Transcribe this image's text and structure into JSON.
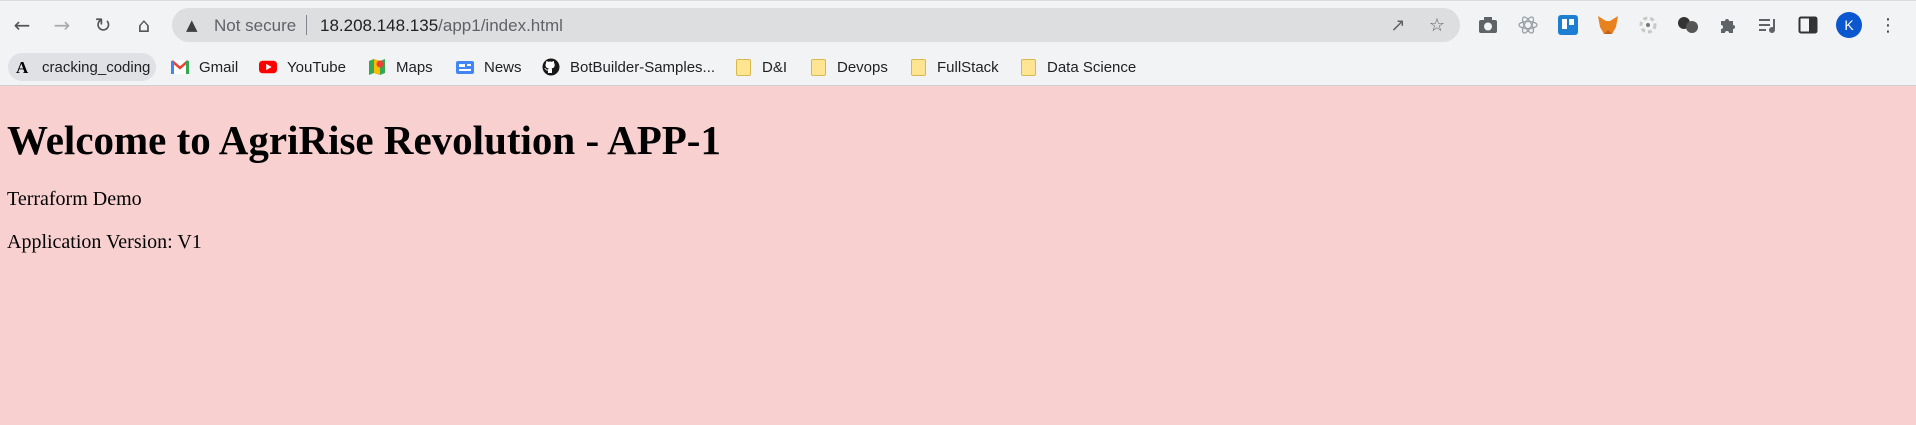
{
  "browser": {
    "omnibox": {
      "security_label": "Not secure",
      "url_host": "18.208.148.135",
      "url_path": "/app1/index.html"
    },
    "profile_initial": "K"
  },
  "bookmarks": [
    {
      "label": "cracking_coding",
      "icon": "a-letter-icon"
    },
    {
      "label": "Gmail",
      "icon": "gmail-icon"
    },
    {
      "label": "YouTube",
      "icon": "youtube-icon"
    },
    {
      "label": "Maps",
      "icon": "maps-icon"
    },
    {
      "label": "News",
      "icon": "news-icon"
    },
    {
      "label": "BotBuilder-Samples...",
      "icon": "github-icon"
    },
    {
      "label": "D&I",
      "icon": "folder-icon"
    },
    {
      "label": "Devops",
      "icon": "folder-icon"
    },
    {
      "label": "FullStack",
      "icon": "folder-icon"
    },
    {
      "label": "Data Science",
      "icon": "folder-icon"
    }
  ],
  "page": {
    "heading": "Welcome to AgriRise Revolution - APP-1",
    "subtitle": "Terraform Demo",
    "version": "Application Version: V1",
    "background_color": "#f9d0d0"
  }
}
